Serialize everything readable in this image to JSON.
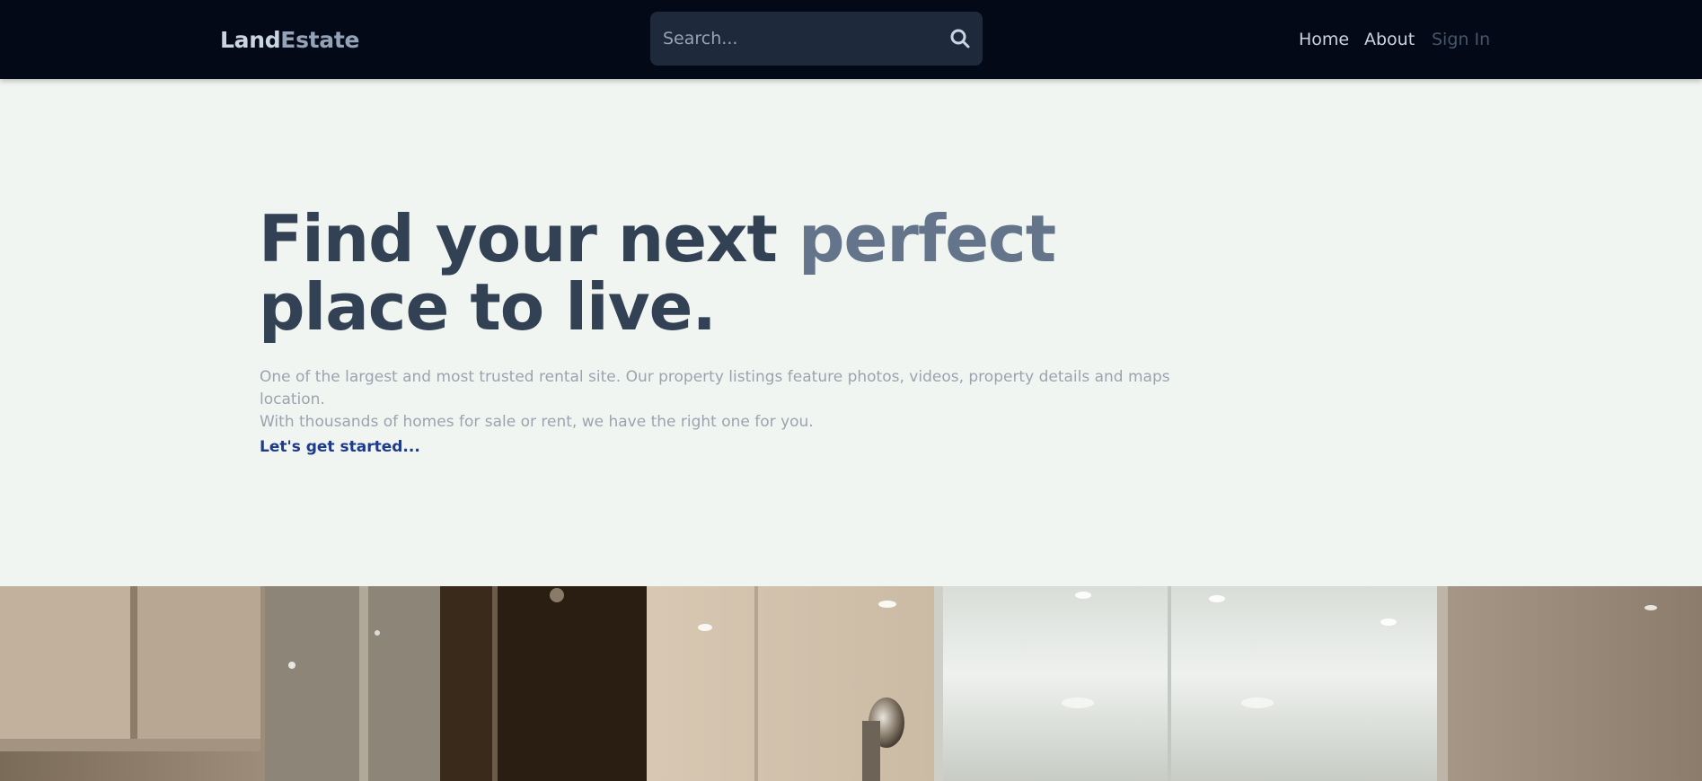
{
  "header": {
    "logo_part1": "Land",
    "logo_part2": "Estate",
    "search_placeholder": "Search...",
    "nav": {
      "home": "Home",
      "about": "About",
      "sign_in": "Sign In"
    }
  },
  "hero": {
    "headline_part1": "Find your next ",
    "headline_accent": "perfect",
    "headline_part2": "place to live.",
    "description_line1": "One of the largest and most trusted rental site. Our property listings feature photos, videos, property details and maps location.",
    "description_line2": "With thousands of homes for sale or rent, we have the right one for you.",
    "cta_label": "Let's get started..."
  },
  "icons": {
    "search": "search-icon"
  },
  "colors": {
    "header_bg": "#030917",
    "hero_bg": "#f0f5f2",
    "headline": "#334155",
    "headline_accent": "#64748b",
    "cta": "#1e3a8a"
  }
}
